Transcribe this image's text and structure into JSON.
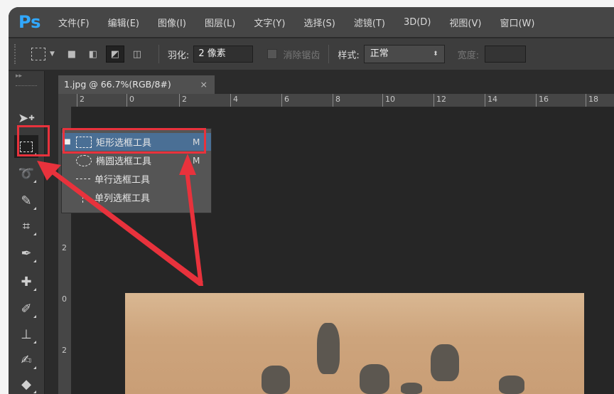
{
  "app": {
    "logo": "Ps",
    "menu": [
      "文件(F)",
      "编辑(E)",
      "图像(I)",
      "图层(L)",
      "文字(Y)",
      "选择(S)",
      "滤镜(T)",
      "3D(D)",
      "视图(V)",
      "窗口(W)"
    ]
  },
  "options": {
    "feather_label": "羽化:",
    "feather_value": "2 像素",
    "antialias_label": "消除锯齿",
    "style_label": "样式:",
    "style_value": "正常",
    "width_label": "宽度:"
  },
  "document": {
    "tab_title": "1.jpg @ 66.7%(RGB/8#)",
    "close_glyph": "×",
    "ruler_top": [
      "2",
      "0",
      "2",
      "4",
      "6",
      "8",
      "10",
      "12",
      "14",
      "16",
      "18"
    ],
    "ruler_left": [
      "2",
      "0",
      "2"
    ]
  },
  "flyout": {
    "items": [
      {
        "label": "矩形选框工具",
        "key": "M",
        "icon": "rect-marquee-icon",
        "selected": true
      },
      {
        "label": "椭圆选框工具",
        "key": "M",
        "icon": "ellipse-marquee-icon",
        "selected": false
      },
      {
        "label": "单行选框工具",
        "key": "",
        "icon": "single-row-marquee-icon",
        "selected": false
      },
      {
        "label": "单列选框工具",
        "key": "",
        "icon": "single-column-marquee-icon",
        "selected": false
      }
    ]
  },
  "tools": [
    "move-tool-icon",
    "rect-marquee-tool-icon",
    "lasso-tool-icon",
    "quick-select-tool-icon",
    "crop-tool-icon",
    "eyedropper-tool-icon",
    "healing-brush-tool-icon",
    "brush-tool-icon",
    "clone-stamp-tool-icon",
    "history-brush-tool-icon",
    "eraser-tool-icon"
  ],
  "colors": {
    "highlight": "#e8323c",
    "accent": "#31a8ff",
    "selection": "#4a6f95"
  }
}
